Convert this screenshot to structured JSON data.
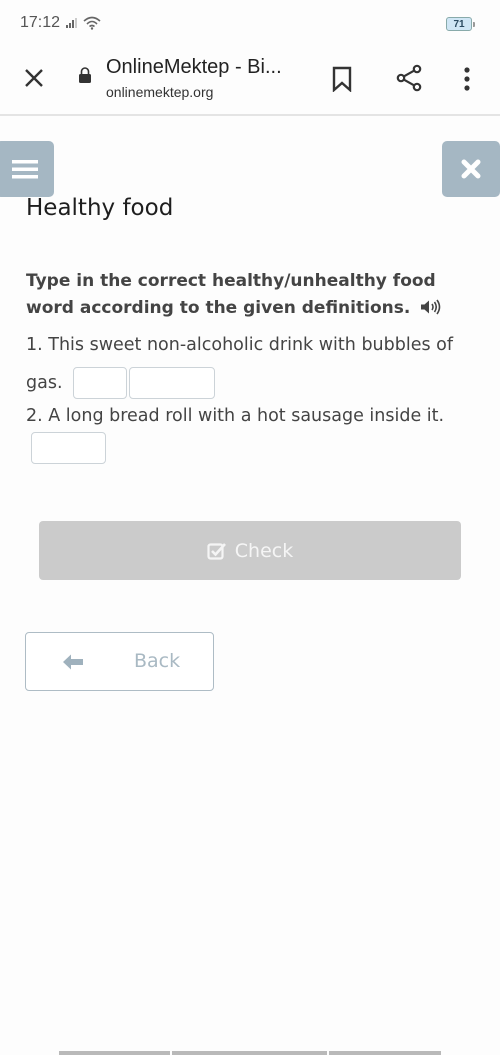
{
  "status_bar": {
    "time": "17:12",
    "battery": "71"
  },
  "browser": {
    "page_title": "OnlineMektep - Bi...",
    "url": "onlinemektep.org",
    "icons": [
      "close-icon",
      "lock-icon",
      "bookmark-icon",
      "share-icon",
      "more-vert-icon"
    ]
  },
  "toolbar": {
    "menu_icon": "hamburger-icon",
    "close_icon": "close-icon",
    "button_color": "#a5b7c3"
  },
  "lesson": {
    "title": "Healthy food",
    "instructions": "Type in the correct healthy/unhealthy food word according to the given definitions.",
    "questions": [
      {
        "text": "1. This sweet non-alcoholic drink with bubbles of gas.",
        "inputs": [
          {
            "value": "",
            "placeholder": ""
          },
          {
            "value": "",
            "placeholder": ""
          }
        ]
      },
      {
        "text": "2. A long bread roll with a hot sausage inside it.",
        "inputs": [
          {
            "value": "",
            "placeholder": ""
          }
        ]
      }
    ]
  },
  "actions": {
    "check_label": "Check",
    "check_color": "#cbcbcb",
    "back_label": "Back",
    "back_color": "#a9b9c3"
  }
}
